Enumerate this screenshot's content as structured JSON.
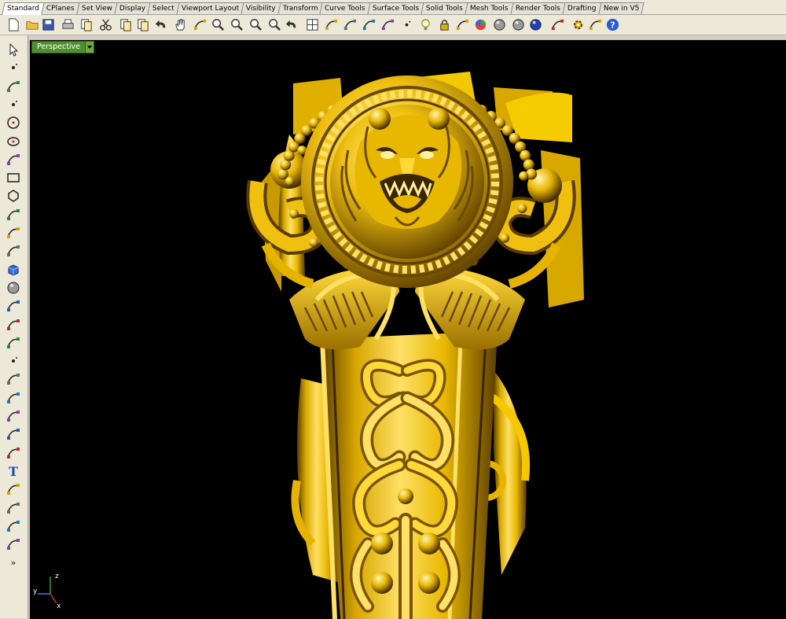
{
  "tabs": [
    "Standard",
    "CPlanes",
    "Set View",
    "Display",
    "Select",
    "Viewport Layout",
    "Visibility",
    "Transform",
    "Curve Tools",
    "Surface Tools",
    "Solid Tools",
    "Mesh Tools",
    "Render Tools",
    "Drafting",
    "New in V5"
  ],
  "active_tab": "Standard",
  "toolbar_icons": [
    "new-document-icon",
    "open-folder-icon",
    "save-icon",
    "print-icon",
    "import-icon",
    "cut-icon",
    "copy-icon",
    "paste-icon",
    "undo-icon",
    "pan-hand-icon",
    "rotate-view-icon",
    "zoom-icon",
    "zoom-window-icon",
    "zoom-extents-icon",
    "zoom-selected-icon",
    "undo-view-icon",
    "four-viewports-icon",
    "options-icon",
    "show-objects-icon",
    "hide-objects-icon",
    "object-properties-icon",
    "points-on-icon",
    "light-bulb-icon",
    "lock-icon",
    "layer-icon",
    "render-color-icon",
    "shaded-sphere-icon",
    "rendered-sphere-icon",
    "blue-sphere-icon",
    "render-spotlight-icon",
    "gear-settings-icon",
    "analysis-icon",
    "help-icon"
  ],
  "left_icons": [
    "select-arrow-icon",
    "point-icon",
    "polyline-icon",
    "curve-points-icon",
    "circle-icon",
    "ellipse-icon",
    "arc-icon",
    "rectangle-icon",
    "polygon-icon",
    "curve-tools-icon",
    "surface-corner-icon",
    "surface-extrude-icon",
    "solid-box-icon",
    "solid-sphere-icon",
    "surface-patch-icon",
    "mesh-icon",
    "transform-icon",
    "point-editing-icon",
    "dimension-icon",
    "group-icon",
    "join-icon",
    "fillet-icon",
    "curve-from-object-icon",
    "text-object-icon",
    "grid-snap-icon",
    "array-icon",
    "analyze-icon",
    "render-icon",
    "more-icon"
  ],
  "viewport": {
    "title": "Perspective",
    "axes": {
      "x": "x",
      "y": "y",
      "z": "z"
    }
  },
  "colors": {
    "gold_light": "#ffe066",
    "gold_mid": "#e0b000",
    "gold_dark": "#6a4a00",
    "viewport_bg": "#000000",
    "label_bg": "#4f8f2f"
  }
}
